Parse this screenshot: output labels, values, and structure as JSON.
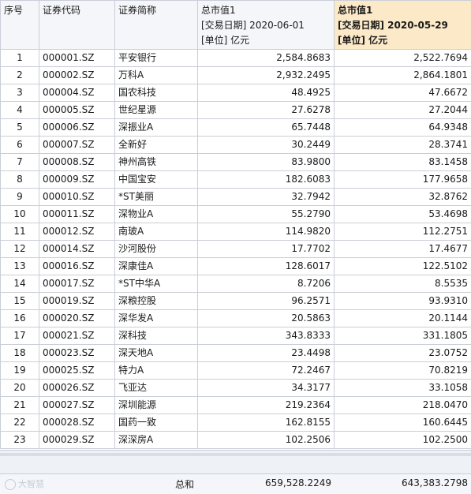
{
  "headers": {
    "index": "序号",
    "code": "证券代码",
    "name": "证券简称",
    "col1": [
      "总市值1",
      "[交易日期] 2020-06-01",
      "[单位] 亿元"
    ],
    "col2": [
      "总市值1",
      "[交易日期] 2020-05-29",
      "[单位] 亿元"
    ]
  },
  "rows": [
    {
      "idx": "1",
      "code": "000001.SZ",
      "name": "平安银行",
      "v1": "2,584.8683",
      "v2": "2,522.7694"
    },
    {
      "idx": "2",
      "code": "000002.SZ",
      "name": "万科A",
      "v1": "2,932.2495",
      "v2": "2,864.1801"
    },
    {
      "idx": "3",
      "code": "000004.SZ",
      "name": "国农科技",
      "v1": "48.4925",
      "v2": "47.6672"
    },
    {
      "idx": "4",
      "code": "000005.SZ",
      "name": "世纪星源",
      "v1": "27.6278",
      "v2": "27.2044"
    },
    {
      "idx": "5",
      "code": "000006.SZ",
      "name": "深振业A",
      "v1": "65.7448",
      "v2": "64.9348"
    },
    {
      "idx": "6",
      "code": "000007.SZ",
      "name": "全新好",
      "v1": "30.2449",
      "v2": "28.3741"
    },
    {
      "idx": "7",
      "code": "000008.SZ",
      "name": "神州高铁",
      "v1": "83.9800",
      "v2": "83.1458"
    },
    {
      "idx": "8",
      "code": "000009.SZ",
      "name": "中国宝安",
      "v1": "182.6083",
      "v2": "177.9658"
    },
    {
      "idx": "9",
      "code": "000010.SZ",
      "name": "*ST美丽",
      "v1": "32.7942",
      "v2": "32.8762"
    },
    {
      "idx": "10",
      "code": "000011.SZ",
      "name": "深物业A",
      "v1": "55.2790",
      "v2": "53.4698"
    },
    {
      "idx": "11",
      "code": "000012.SZ",
      "name": "南玻A",
      "v1": "114.9820",
      "v2": "112.2751"
    },
    {
      "idx": "12",
      "code": "000014.SZ",
      "name": "沙河股份",
      "v1": "17.7702",
      "v2": "17.4677"
    },
    {
      "idx": "13",
      "code": "000016.SZ",
      "name": "深康佳A",
      "v1": "128.6017",
      "v2": "122.5102"
    },
    {
      "idx": "14",
      "code": "000017.SZ",
      "name": "*ST中华A",
      "v1": "8.7206",
      "v2": "8.5535"
    },
    {
      "idx": "15",
      "code": "000019.SZ",
      "name": "深粮控股",
      "v1": "96.2571",
      "v2": "93.9310"
    },
    {
      "idx": "16",
      "code": "000020.SZ",
      "name": "深华发A",
      "v1": "20.5863",
      "v2": "20.1144"
    },
    {
      "idx": "17",
      "code": "000021.SZ",
      "name": "深科技",
      "v1": "343.8333",
      "v2": "331.1805"
    },
    {
      "idx": "18",
      "code": "000023.SZ",
      "name": "深天地A",
      "v1": "23.4498",
      "v2": "23.0752"
    },
    {
      "idx": "19",
      "code": "000025.SZ",
      "name": "特力A",
      "v1": "72.2467",
      "v2": "70.8219"
    },
    {
      "idx": "20",
      "code": "000026.SZ",
      "name": "飞亚达",
      "v1": "34.3177",
      "v2": "33.1058"
    },
    {
      "idx": "21",
      "code": "000027.SZ",
      "name": "深圳能源",
      "v1": "219.2364",
      "v2": "218.0470"
    },
    {
      "idx": "22",
      "code": "000028.SZ",
      "name": "国药一致",
      "v1": "162.8155",
      "v2": "160.6445"
    },
    {
      "idx": "23",
      "code": "000029.SZ",
      "name": "深深房A",
      "v1": "102.2506",
      "v2": "102.2500"
    }
  ],
  "footer": {
    "logo_text": "大智慧",
    "total_label": "总和",
    "total1": "659,528.2249",
    "total2": "643,383.2798"
  },
  "colors": {
    "highlight_header": "#fbe9c8",
    "header_bg": "#f4f6fa",
    "grid_line": "#c9ced6"
  }
}
